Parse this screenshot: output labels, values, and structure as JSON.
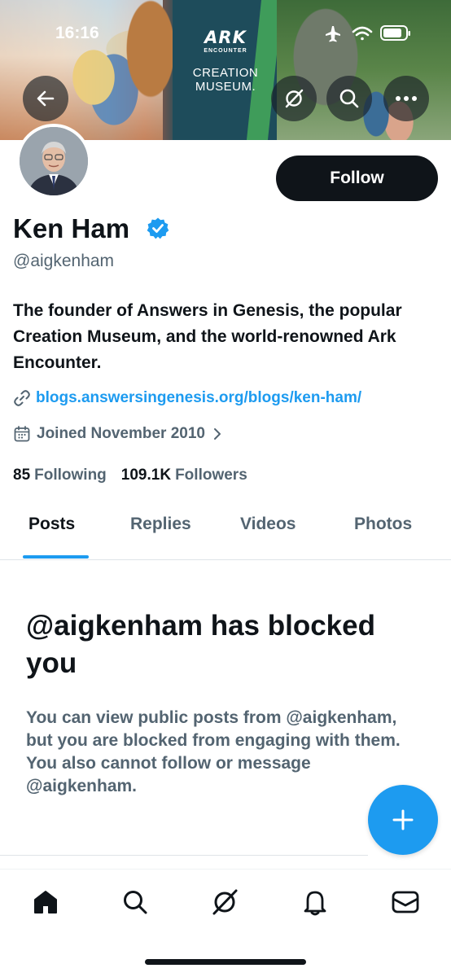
{
  "status_bar": {
    "time": "16:16"
  },
  "banner": {
    "logo_main": "ARK",
    "logo_sub": "ENCOUNTER",
    "logo_line1": "CREATION",
    "logo_line2": "MUSEUM."
  },
  "header_buttons": {
    "back_icon": "arrow-left-icon",
    "grok_icon": "grok-icon",
    "search_icon": "search-icon",
    "more_icon": "more-icon"
  },
  "profile": {
    "name": "Ken Ham",
    "handle": "@aigkenham",
    "bio": "The founder of Answers in Genesis, the popular Creation Museum, and the world-renowned Ark Encounter.",
    "link": "blogs.answersingenesis.org/blogs/ken-ham/",
    "joined": "Joined November 2010",
    "following_count": "85",
    "following_label": "Following",
    "followers_count": "109.1K",
    "followers_label": "Followers",
    "follow_button": "Follow"
  },
  "tabs": [
    {
      "label": "Posts",
      "active": true
    },
    {
      "label": "Replies",
      "active": false
    },
    {
      "label": "Videos",
      "active": false
    },
    {
      "label": "Photos",
      "active": false
    }
  ],
  "blocked": {
    "title": "@aigkenham has blocked you",
    "description": "You can view public posts from @aigkenham, but you are blocked from engaging with them. You also cannot follow or message @aigkenham."
  },
  "bottom_nav": [
    "home-icon",
    "search-icon",
    "grok-icon",
    "notifications-icon",
    "messages-icon"
  ],
  "colors": {
    "accent": "#1d9bf0",
    "text": "#0f1419",
    "secondary": "#536471"
  }
}
